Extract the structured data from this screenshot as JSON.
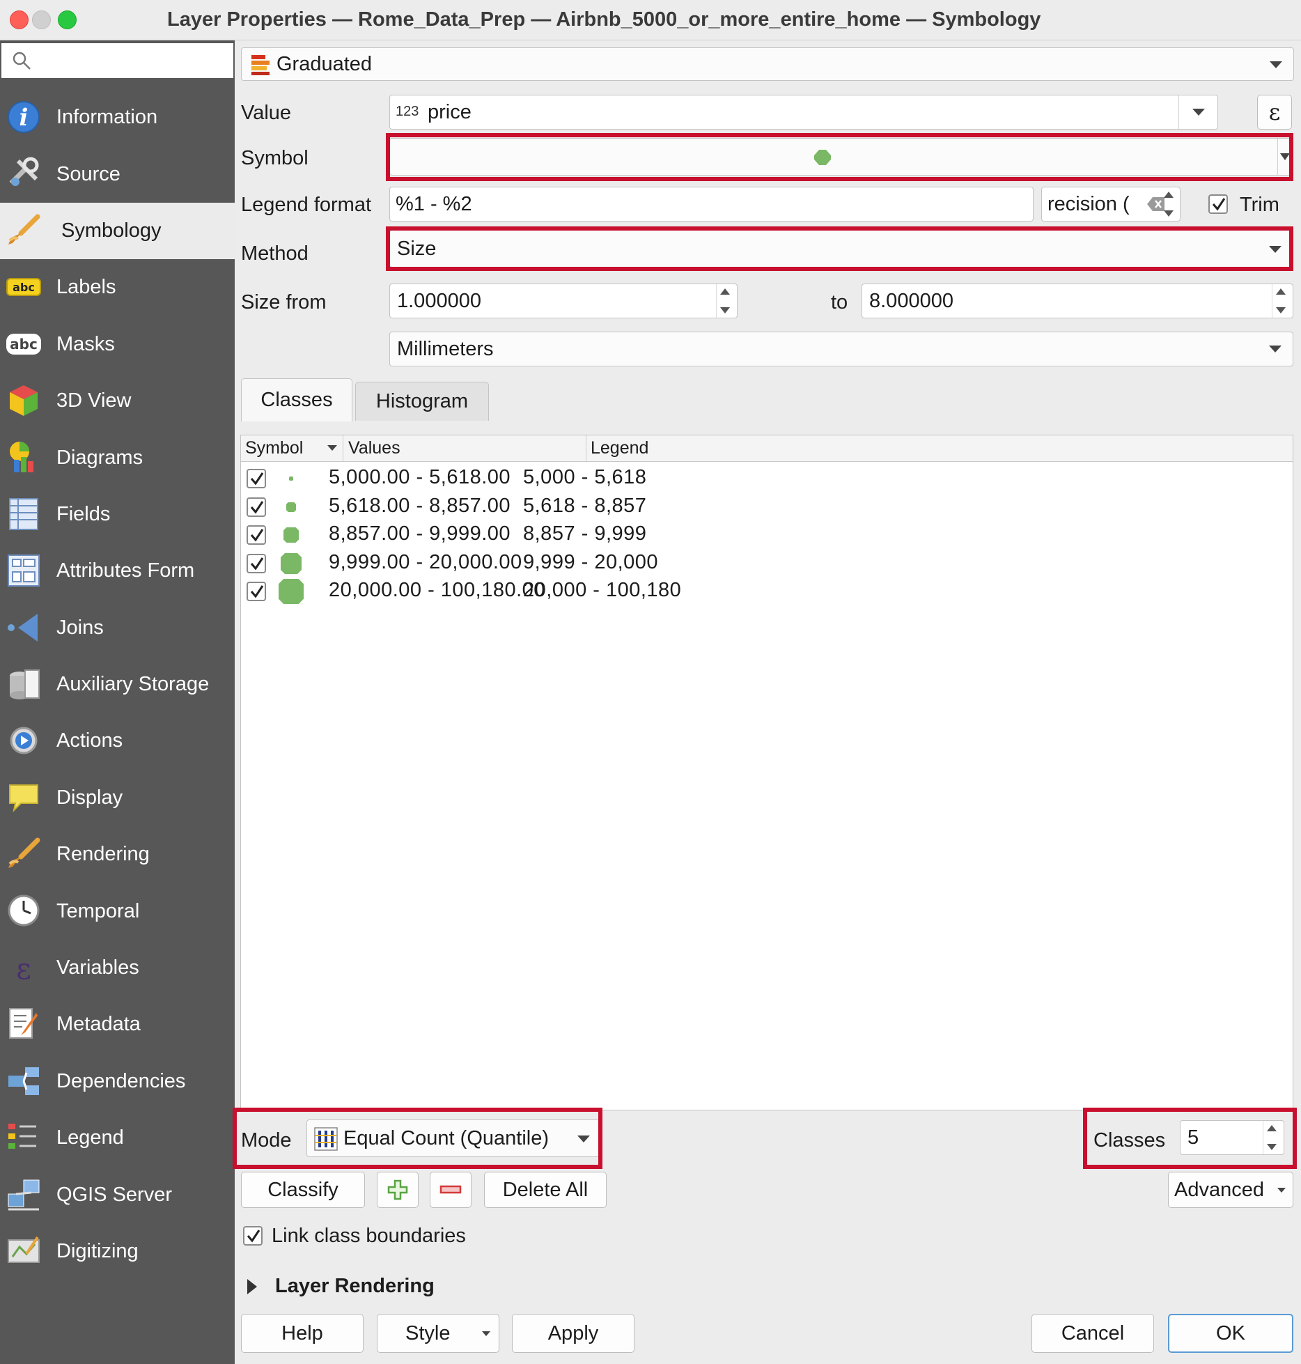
{
  "window": {
    "title": "Layer Properties — Rome_Data_Prep — Airbnb_5000_or_more_entire_home — Symbology"
  },
  "sidebar": {
    "search_placeholder": "",
    "items": [
      {
        "label": "Information",
        "icon": "info-icon"
      },
      {
        "label": "Source",
        "icon": "source-wrench-icon"
      },
      {
        "label": "Symbology",
        "icon": "paintbrush-icon",
        "selected": true
      },
      {
        "label": "Labels",
        "icon": "labels-abc-icon"
      },
      {
        "label": "Masks",
        "icon": "masks-abc-icon"
      },
      {
        "label": "3D View",
        "icon": "cube-3d-icon"
      },
      {
        "label": "Diagrams",
        "icon": "diagrams-icon"
      },
      {
        "label": "Fields",
        "icon": "fields-table-icon"
      },
      {
        "label": "Attributes Form",
        "icon": "attributes-form-icon"
      },
      {
        "label": "Joins",
        "icon": "joins-icon"
      },
      {
        "label": "Auxiliary Storage",
        "icon": "database-icon"
      },
      {
        "label": "Actions",
        "icon": "gear-play-icon"
      },
      {
        "label": "Display",
        "icon": "speech-bubble-icon"
      },
      {
        "label": "Rendering",
        "icon": "paintbrush-icon"
      },
      {
        "label": "Temporal",
        "icon": "clock-icon"
      },
      {
        "label": "Variables",
        "icon": "epsilon-icon"
      },
      {
        "label": "Metadata",
        "icon": "metadata-pencil-icon"
      },
      {
        "label": "Dependencies",
        "icon": "dependencies-icon"
      },
      {
        "label": "Legend",
        "icon": "legend-icon"
      },
      {
        "label": "QGIS Server",
        "icon": "server-icon"
      },
      {
        "label": "Digitizing",
        "icon": "digitizing-icon"
      }
    ]
  },
  "renderer": {
    "value": "Graduated"
  },
  "form": {
    "value_label": "Value",
    "value_type": "123",
    "value_field": "price",
    "symbol_label": "Symbol",
    "legend_format_label": "Legend format",
    "legend_format": "%1 - %2",
    "precision": "recision (",
    "trim_label": "Trim",
    "method_label": "Method",
    "method": "Size",
    "size_from_label": "Size from",
    "size_from": "1.000000",
    "to_label": "to",
    "size_to": "8.000000",
    "unit": "Millimeters"
  },
  "tabs": [
    {
      "label": "Classes",
      "active": true
    },
    {
      "label": "Histogram",
      "active": false
    }
  ],
  "table": {
    "headers": [
      "Symbol",
      "Values",
      "Legend"
    ],
    "rows": [
      {
        "checked": true,
        "symbol_size": 1,
        "values": "5,000.00 - 5,618.00",
        "legend": "5,000 - 5,618"
      },
      {
        "checked": true,
        "symbol_size": 2,
        "values": "5,618.00 - 8,857.00",
        "legend": "5,618 - 8,857"
      },
      {
        "checked": true,
        "symbol_size": 3,
        "values": "8,857.00 - 9,999.00",
        "legend": "8,857 - 9,999"
      },
      {
        "checked": true,
        "symbol_size": 4,
        "values": "9,999.00 - 20,000.00",
        "legend": "9,999 - 20,000"
      },
      {
        "checked": true,
        "symbol_size": 5,
        "values": "20,000.00 - 100,180.00",
        "legend": "20,000 - 100,180"
      }
    ]
  },
  "mode": {
    "label": "Mode",
    "value": "Equal Count (Quantile)"
  },
  "classes": {
    "label": "Classes",
    "value": "5"
  },
  "buttons": {
    "classify": "Classify",
    "delete_all": "Delete All",
    "advanced": "Advanced",
    "help": "Help",
    "style": "Style",
    "apply": "Apply",
    "cancel": "Cancel",
    "ok": "OK"
  },
  "link_class_boundaries": "Link class boundaries",
  "layer_rendering": "Layer Rendering",
  "colors": {
    "accent_red": "#c8102e",
    "symbol_green": "#7ab865",
    "sidebar_bg": "#575757"
  }
}
